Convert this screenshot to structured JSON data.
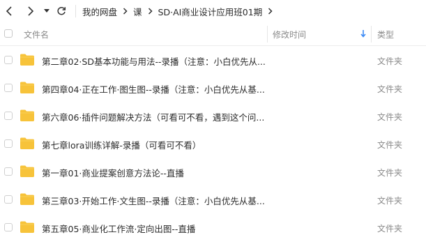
{
  "toolbar": {
    "back_icon": "chevron-left-icon",
    "forward_icon": "chevron-right-icon",
    "history_icon": "caret-down-icon",
    "refresh_icon": "refresh-icon"
  },
  "breadcrumb": [
    "我的网盘",
    "课",
    "SD·AI商业设计应用班01期"
  ],
  "columns": {
    "name": "文件名",
    "modified": "修改时间",
    "type": "类型"
  },
  "colors": {
    "folder": "#F7C33A",
    "sort_arrow": "#3D8BF5",
    "text": "#2b2b2b",
    "muted": "#8a8a8a"
  },
  "files": [
    {
      "name": "第二章02·SD基本功能与用法--录播（注意：小白优先从...",
      "type": "文件夹",
      "icon": "folder-icon"
    },
    {
      "name": "第四章04·正在工作·图生图--录播（注意：小白优先从基...",
      "type": "文件夹",
      "icon": "folder-icon"
    },
    {
      "name": "第六章06·插件问题解决方法（可看可不看，遇到这个问...",
      "type": "文件夹",
      "icon": "folder-icon"
    },
    {
      "name": "第七章lora训练详解-录播（可看可不看）",
      "type": "文件夹",
      "icon": "folder-icon"
    },
    {
      "name": "第一章01·商业提案创意方法论--直播",
      "type": "文件夹",
      "icon": "folder-icon"
    },
    {
      "name": "第三章03·开始工作·文生图--录播（注意：小白优先从基...",
      "type": "文件夹",
      "icon": "folder-icon"
    },
    {
      "name": "第五章05·商业化工作流·定向出图--直播",
      "type": "文件夹",
      "icon": "folder-icon"
    }
  ]
}
